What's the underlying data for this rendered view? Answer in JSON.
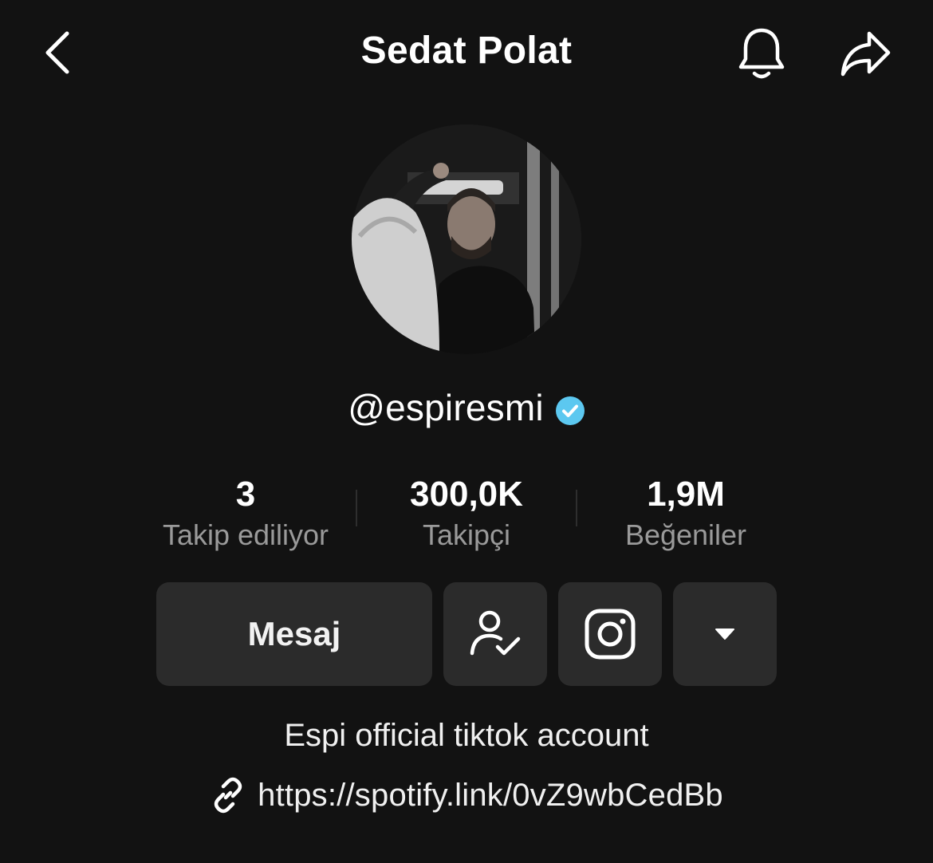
{
  "header": {
    "title": "Sedat Polat",
    "back_icon": "chevron-left-icon",
    "bell_icon": "bell-icon",
    "share_icon": "share-arrow-icon"
  },
  "profile": {
    "handle": "@espiresmi",
    "verified": true,
    "verified_color": "#5cc8f0"
  },
  "stats": [
    {
      "value": "3",
      "label": "Takip ediliyor"
    },
    {
      "value": "300,0K",
      "label": "Takipçi"
    },
    {
      "value": "1,9M",
      "label": "Beğeniler"
    }
  ],
  "actions": {
    "message_label": "Mesaj",
    "following_icon": "user-check-icon",
    "instagram_icon": "instagram-icon",
    "more_icon": "caret-down-icon"
  },
  "bio": {
    "text": "Espi official tiktok account",
    "link": "https://spotify.link/0vZ9wbCedBb",
    "link_icon": "link-icon"
  },
  "colors": {
    "background": "#121212",
    "button_bg": "#2b2b2b",
    "label_gray": "#9a9a9a"
  }
}
